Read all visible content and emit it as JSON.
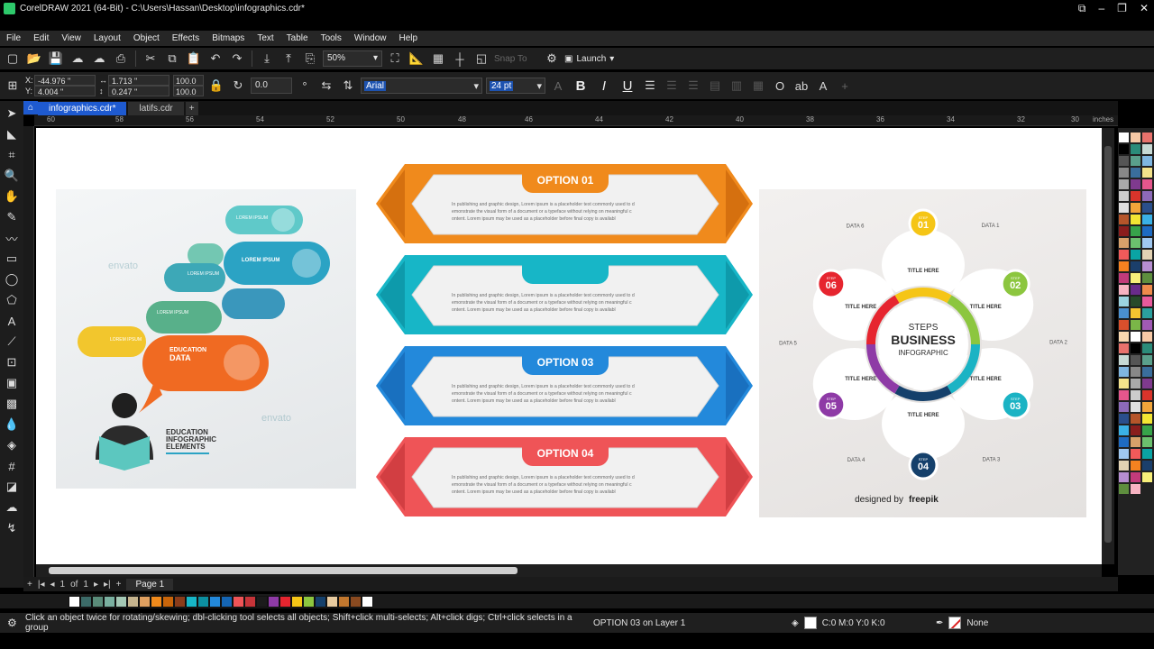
{
  "window": {
    "title": "CorelDRAW 2021 (64-Bit) - C:\\Users\\Hassan\\Desktop\\infographics.cdr*",
    "controls": [
      "restore",
      "minimize",
      "maximize",
      "close"
    ]
  },
  "menu": [
    "File",
    "Edit",
    "View",
    "Layout",
    "Object",
    "Effects",
    "Bitmaps",
    "Text",
    "Table",
    "Tools",
    "Window",
    "Help"
  ],
  "toolbar": {
    "zoom": "50%",
    "snap_to": "Snap To",
    "launch": "Launch"
  },
  "property_bar": {
    "x": "-44.976 \"",
    "y": "4.004 \"",
    "w": "1.713 \"",
    "h": "0.247 \"",
    "scale_w": "100.0",
    "scale_h": "100.0",
    "angle": "0.0",
    "font": "Arial",
    "font_size": "24 pt",
    "bold": "B",
    "italic": "I",
    "underline": "U"
  },
  "tabs": [
    "infographics.cdr*",
    "latifs.cdr"
  ],
  "ruler": {
    "unit": "inches",
    "ticks": [
      "60",
      "58",
      "56",
      "54",
      "52",
      "50",
      "48",
      "46",
      "44",
      "42",
      "40",
      "38",
      "36",
      "34",
      "32",
      "30"
    ]
  },
  "art_left": {
    "labels": [
      "LOREM IPSUM",
      "LOREM IPSUM",
      "LOREM IPSUM",
      "LOREM IPSUM",
      "LOREM IPSUM"
    ],
    "highlight_title": "EDUCATION",
    "highlight_sub": "DATA",
    "footer": [
      "EDUCATION",
      "INFOGRAPHIC",
      "ELEMENTS"
    ],
    "watermark": "envato"
  },
  "art_middle": {
    "options": [
      {
        "label": "OPTION 01",
        "color": "#f08a1c",
        "dark": "#c9650a"
      },
      {
        "label": "",
        "color": "#17b6c7",
        "dark": "#0c8fa0"
      },
      {
        "label": "OPTION 03",
        "color": "#2389db",
        "dark": "#1565b3"
      },
      {
        "label": "OPTION 04",
        "color": "#ef5457",
        "dark": "#c63439"
      }
    ],
    "body": "In publishing and graphic design, Lorem ipsum is a placeholder text commonly used to demonstrate the visual form of a document or a typeface without relying on meaningful content. Lorem ipsum may be used as a placeholder before final copy is availabl"
  },
  "art_right": {
    "center": [
      "STEPS",
      "BUSINESS",
      "INFOGRAPHIC"
    ],
    "steps": [
      {
        "num": "01",
        "color": "#f5c516"
      },
      {
        "num": "02",
        "color": "#8cc63f"
      },
      {
        "num": "03",
        "color": "#1bb3c4"
      },
      {
        "num": "04",
        "color": "#15406b"
      },
      {
        "num": "05",
        "color": "#8e3aa6"
      },
      {
        "num": "06",
        "color": "#e6252f"
      }
    ],
    "step_word": "STEP",
    "title_here": "TITLE HERE",
    "data_labels": [
      "DATA 1",
      "DATA 2",
      "DATA 3",
      "DATA 4",
      "DATA 5",
      "DATA 6"
    ],
    "credit": "designed by",
    "brand": "freepik"
  },
  "page_nav": {
    "current": "1",
    "of": "of",
    "total": "1",
    "page": "Page 1"
  },
  "status": {
    "hint": "Click an object twice for rotating/skewing; dbl-clicking tool selects all objects; Shift+click multi-selects; Alt+click digs; Ctrl+click selects in a group",
    "object": "OPTION 03 on Layer 1",
    "fill": "C:0 M:0 Y:0 K:0",
    "outline": "None"
  },
  "colors": {
    "accent": "#1e5ad0",
    "chrome": "#1f1f1f"
  }
}
